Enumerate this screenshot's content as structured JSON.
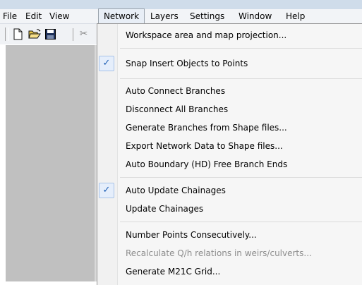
{
  "menubar": {
    "items": [
      "File",
      "Edit",
      "View",
      "Network",
      "Layers",
      "Settings",
      "Window",
      "Help"
    ]
  },
  "toolbar": {
    "icons": [
      "new-document-icon",
      "open-folder-icon",
      "save-floppy-icon",
      "cut-scissors-icon"
    ],
    "cut_glyph": "✂"
  },
  "network_menu": {
    "check_glyph": "✓",
    "items": [
      {
        "label": "Workspace area and map projection...",
        "checked": false,
        "enabled": true
      },
      {
        "label": "Snap Insert Objects to Points",
        "checked": true,
        "enabled": true
      },
      {
        "label": "Auto Connect Branches",
        "checked": false,
        "enabled": true
      },
      {
        "label": "Disconnect All Branches",
        "checked": false,
        "enabled": true
      },
      {
        "label": "Generate Branches from Shape files...",
        "checked": false,
        "enabled": true
      },
      {
        "label": "Export Network Data to Shape files...",
        "checked": false,
        "enabled": true
      },
      {
        "label": "Auto Boundary (HD) Free Branch Ends",
        "checked": false,
        "enabled": true
      },
      {
        "label": "Auto Update Chainages",
        "checked": true,
        "enabled": true
      },
      {
        "label": "Update Chainages",
        "checked": false,
        "enabled": true
      },
      {
        "label": "Number Points Consecutively...",
        "checked": false,
        "enabled": true
      },
      {
        "label": "Recalculate Q/h relations in weirs/culverts...",
        "checked": false,
        "enabled": false
      },
      {
        "label": "Generate M21C Grid...",
        "checked": false,
        "enabled": true
      }
    ]
  }
}
